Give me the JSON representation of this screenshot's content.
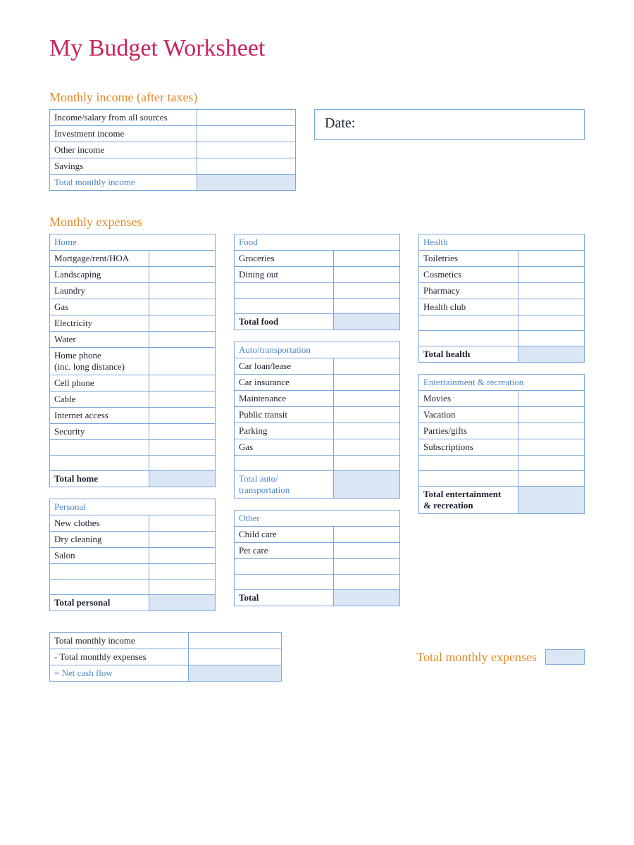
{
  "title": "My Budget Worksheet",
  "sections": {
    "income_header": "Monthly income (after taxes)",
    "expenses_header": "Monthly expenses"
  },
  "date_label": "Date:",
  "income": {
    "rows": [
      "Income/salary from all sources",
      "Investment income",
      "Other income",
      "Savings"
    ],
    "total_label": "Total monthly income"
  },
  "expenses": {
    "home": {
      "header": "Home",
      "rows": [
        "Mortgage/rent/HOA",
        "Landscaping",
        "Laundry",
        "Gas",
        "Electricity",
        "Water"
      ],
      "phone_line1": "Home phone",
      "phone_line2": "(inc. long distance)",
      "rows2": [
        "Cell phone",
        "Cable",
        "Internet access",
        "Security"
      ],
      "total_label": "Total home"
    },
    "personal": {
      "header": "Personal",
      "rows": [
        "New clothes",
        "Dry cleaning",
        "Salon"
      ],
      "total_label": "Total personal"
    },
    "food": {
      "header": "Food",
      "rows": [
        "Groceries",
        "Dining out"
      ],
      "total_label": "Total food"
    },
    "auto": {
      "header": "Auto/transportation",
      "rows": [
        "Car loan/lease",
        "Car insurance",
        "Maintenance",
        "Public transit",
        "Parking",
        "Gas"
      ],
      "total_line1": "Total auto/",
      "total_line2": "transportation"
    },
    "other": {
      "header": "Other",
      "rows": [
        "Child care",
        "Pet care"
      ],
      "total_label": "Total"
    },
    "health": {
      "header": "Health",
      "rows": [
        "Toiletries",
        "Cosmetics",
        "Pharmacy",
        "Health club"
      ],
      "total_label": "Total health"
    },
    "ent": {
      "header": "Entertainment & recreation",
      "rows": [
        "Movies",
        "Vacation",
        "Parties/gifts",
        "Subscriptions"
      ],
      "total_line1": "Total entertainment",
      "total_line2": "& recreation"
    }
  },
  "summary": {
    "row1": "Total monthly income",
    "row2": "- Total monthly expenses",
    "row3": "= Net cash flow",
    "tme_label": "Total monthly expenses"
  }
}
